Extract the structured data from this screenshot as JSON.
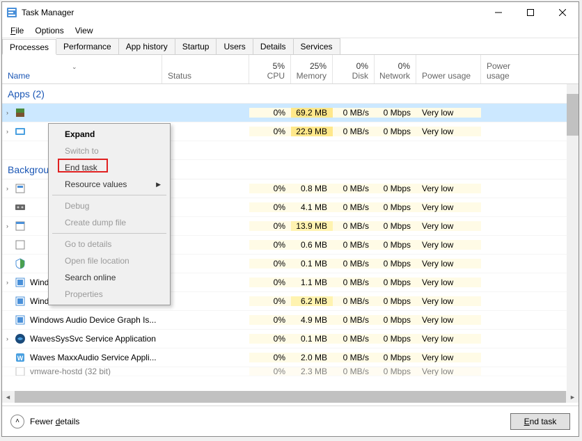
{
  "titlebar": {
    "title": "Task Manager"
  },
  "menubar": {
    "file": "File",
    "options": "Options",
    "view": "View"
  },
  "tabs": {
    "processes": "Processes",
    "performance": "Performance",
    "app_history": "App history",
    "startup": "Startup",
    "users": "Users",
    "details": "Details",
    "services": "Services"
  },
  "headers": {
    "name": "Name",
    "status": "Status",
    "cpu_pct": "5%",
    "cpu": "CPU",
    "mem_pct": "25%",
    "mem": "Memory",
    "disk_pct": "0%",
    "disk": "Disk",
    "net_pct": "0%",
    "net": "Network",
    "power": "Power usage",
    "power2": "Power usage"
  },
  "groups": {
    "apps": "Apps (2)",
    "bg": "Background"
  },
  "rows": [
    {
      "name": "",
      "cpu": "0%",
      "mem": "69.2 MB",
      "disk": "0 MB/s",
      "net": "0 Mbps",
      "power": "Very low"
    },
    {
      "name": "",
      "cpu": "0%",
      "mem": "22.9 MB",
      "disk": "0 MB/s",
      "net": "0 Mbps",
      "power": "Very low"
    },
    {
      "name": "",
      "cpu": "0%",
      "mem": "0.8 MB",
      "disk": "0 MB/s",
      "net": "0 Mbps",
      "power": "Very low"
    },
    {
      "name": "",
      "cpu": "0%",
      "mem": "4.1 MB",
      "disk": "0 MB/s",
      "net": "0 Mbps",
      "power": "Very low"
    },
    {
      "name": "",
      "cpu": "0%",
      "mem": "13.9 MB",
      "disk": "0 MB/s",
      "net": "0 Mbps",
      "power": "Very low"
    },
    {
      "name": "",
      "cpu": "0%",
      "mem": "0.6 MB",
      "disk": "0 MB/s",
      "net": "0 Mbps",
      "power": "Very low"
    },
    {
      "name": "",
      "cpu": "0%",
      "mem": "0.1 MB",
      "disk": "0 MB/s",
      "net": "0 Mbps",
      "power": "Very low"
    },
    {
      "name": "Windows Security Health Service",
      "cpu": "0%",
      "mem": "1.1 MB",
      "disk": "0 MB/s",
      "net": "0 Mbps",
      "power": "Very low"
    },
    {
      "name": "Windows Defender SmartScreen",
      "cpu": "0%",
      "mem": "6.2 MB",
      "disk": "0 MB/s",
      "net": "0 Mbps",
      "power": "Very low"
    },
    {
      "name": "Windows Audio Device Graph Is...",
      "cpu": "0%",
      "mem": "4.9 MB",
      "disk": "0 MB/s",
      "net": "0 Mbps",
      "power": "Very low"
    },
    {
      "name": "WavesSysSvc Service Application",
      "cpu": "0%",
      "mem": "0.1 MB",
      "disk": "0 MB/s",
      "net": "0 Mbps",
      "power": "Very low"
    },
    {
      "name": "Waves MaxxAudio Service Appli...",
      "cpu": "0%",
      "mem": "2.0 MB",
      "disk": "0 MB/s",
      "net": "0 Mbps",
      "power": "Very low"
    },
    {
      "name": "vmware-hostd (32 bit)",
      "cpu": "0%",
      "mem": "2.3 MB",
      "disk": "0 MB/s",
      "net": "0 Mbps",
      "power": "Very low"
    }
  ],
  "context_menu": {
    "expand": "Expand",
    "switch_to": "Switch to",
    "end_task": "End task",
    "resource_values": "Resource values",
    "debug": "Debug",
    "create_dump": "Create dump file",
    "go_details": "Go to details",
    "open_loc": "Open file location",
    "search_online": "Search online",
    "properties": "Properties"
  },
  "footer": {
    "fewer": "Fewer details",
    "end_task": "End task",
    "fewer_prefix": "Fewer ",
    "fewer_u": "d",
    "fewer_suffix": "etails",
    "end_prefix": "",
    "end_u": "E",
    "end_suffix": "nd task"
  }
}
